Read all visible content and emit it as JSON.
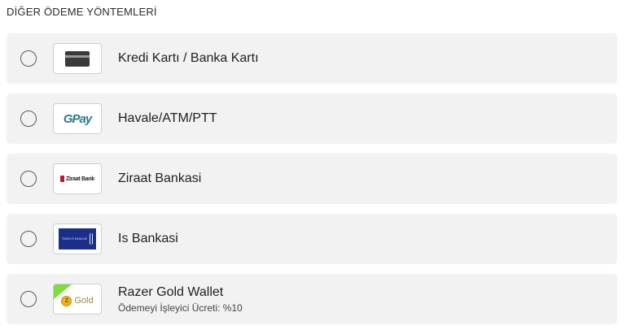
{
  "section_title": "DİĞER ÖDEME YÖNTEMLERİ",
  "methods": [
    {
      "label": "Kredi Kartı / Banka Kartı",
      "icon": "credit-card-icon"
    },
    {
      "label": "Havale/ATM/PTT",
      "icon": "gpay-logo",
      "logo_text": "GPay"
    },
    {
      "label": "Ziraat Bankasi",
      "icon": "ziraat-bank-logo",
      "logo_text": "Ziraat Bank"
    },
    {
      "label": "Is Bankasi",
      "icon": "is-bankasi-logo",
      "logo_text": "TÜRKİYE BANKASI"
    },
    {
      "label": "Razer Gold Wallet",
      "sublabel": "Ödemeyi İşleyici Ücreti: %10",
      "icon": "razer-gold-logo",
      "logo_text": "Gold"
    }
  ],
  "colors": {
    "row_background": "#f2f2f2",
    "ziraat_red": "#c8102e",
    "is_bankasi_blue": "#1b2f8a",
    "gpay_teal": "#2a7a8f",
    "razer_green": "#7fdc3f",
    "razer_gold": "#f2b01e"
  }
}
